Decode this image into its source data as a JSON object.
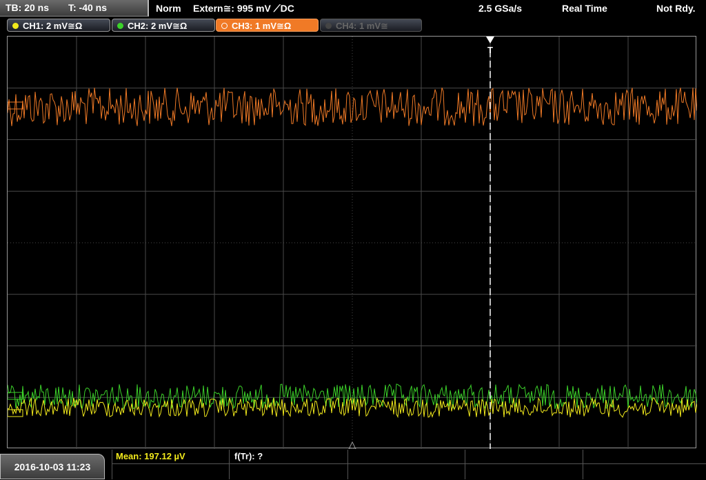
{
  "header": {
    "timebase": "TB: 20 ns",
    "trigger_time": "T: -40 ns",
    "trigger_mode": "Norm",
    "trigger_source": "Extern≅: 995 mV ⟋DC",
    "sample_rate": "2.5 GSa/s",
    "acq_mode": "Real Time",
    "status": "Not Rdy."
  },
  "channels": [
    {
      "label": "CH1: 2 mV≅Ω",
      "color": "#f2ea1c",
      "active": false,
      "enabled": true
    },
    {
      "label": "CH2: 2 mV≅Ω",
      "color": "#3cd22a",
      "active": false,
      "enabled": true
    },
    {
      "label": "CH3: 1 mV≅Ω",
      "color": "#f07a26",
      "active": true,
      "enabled": true
    },
    {
      "label": "CH4: 1 mV≅",
      "color": "#666666",
      "active": false,
      "enabled": false
    }
  ],
  "trigger_marker": "T",
  "bottom": {
    "datetime": "2016-10-03 11:23",
    "mean": "Mean: 197.12 µV",
    "freq": "f(Tr): ?"
  },
  "colors": {
    "ch1": "#f2ea1c",
    "ch2": "#3cd22a",
    "ch3": "#f07a26",
    "grid": "#4a4a4a"
  }
}
